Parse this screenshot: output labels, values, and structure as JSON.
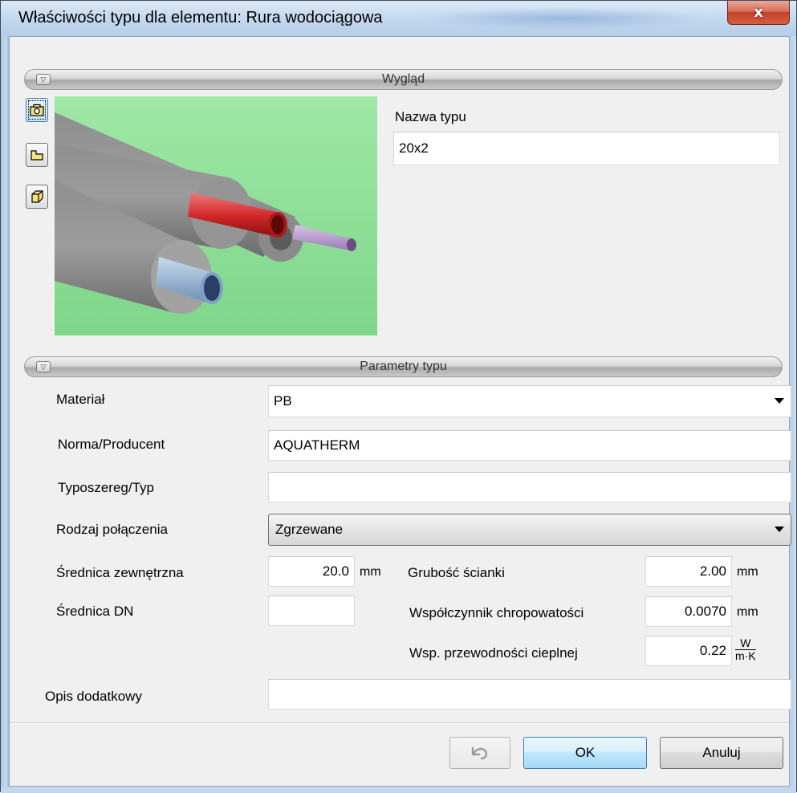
{
  "window": {
    "title": "Właściwości typu dla elementu: Rura wodociągowa",
    "close_label": "x"
  },
  "sections": {
    "appearance": "Wygląd",
    "parameters": "Parametry typu"
  },
  "side_buttons": [
    "camera-icon",
    "folder-icon",
    "cube-icon"
  ],
  "type_name": {
    "label": "Nazwa typu",
    "value": "20x2"
  },
  "params": {
    "material_label": "Materiał",
    "material_value": "PB",
    "norm_label": "Norma/Producent",
    "norm_value": "AQUATHERM",
    "series_label": "Typoszereg/Typ",
    "series_value": "",
    "connection_label": "Rodzaj połączenia",
    "connection_value": "Zgrzewane",
    "outer_diameter_label": "Średnica zewnętrzna",
    "outer_diameter_value": "20.0",
    "outer_diameter_unit": "mm",
    "wall_label": "Grubość ścianki",
    "wall_value": "2.00",
    "wall_unit": "mm",
    "dn_label": "Średnica DN",
    "dn_value": "",
    "roughness_label": "Współczynnik chropowatości",
    "roughness_value": "0.0070",
    "roughness_unit": "mm",
    "conductivity_label": "Wsp. przewodności cieplnej",
    "conductivity_value": "0.22",
    "conductivity_unit_num": "W",
    "conductivity_unit_den": "m·K",
    "description_label": "Opis dodatkowy",
    "description_value": ""
  },
  "buttons": {
    "undo_icon": "undo-icon",
    "ok": "OK",
    "cancel": "Anuluj"
  },
  "colors": {
    "preview_bg": "#9fe4a2",
    "close_red": "#c4412a",
    "title_bg": "#c7daf0"
  }
}
